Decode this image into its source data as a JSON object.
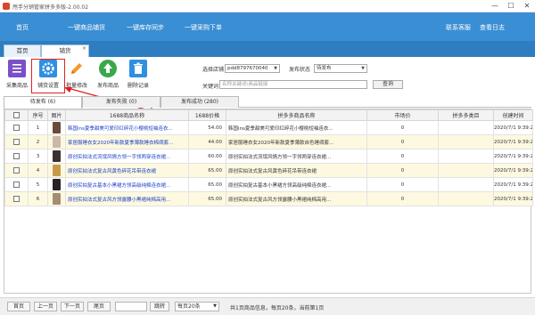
{
  "window": {
    "title": "甩手分销管家拼多多版-2.00.02",
    "controls": [
      "—",
      "☐",
      "✕"
    ]
  },
  "menu": {
    "items": [
      "首页",
      "一键商品铺货",
      "一键库存同步",
      "一键采购下单"
    ],
    "right_items": [
      "联系客服",
      "查看日志"
    ]
  },
  "tabs": [
    {
      "label": "首页",
      "active": false
    },
    {
      "label": "铺货",
      "active": true
    }
  ],
  "toolbar": {
    "buttons": [
      {
        "label": "采集商品",
        "icon": "collect-icon",
        "color": "#7b4fc8"
      },
      {
        "label": "铺货设置",
        "icon": "gear-icon",
        "color": "#2f8fe0"
      },
      {
        "label": "批量修改",
        "icon": "pencil-icon",
        "color": "#f39a2a"
      },
      {
        "label": "发布商品",
        "icon": "upload-icon",
        "color": "#3aa84a"
      },
      {
        "label": "删除记录",
        "icon": "trash-icon",
        "color": "#2f8fe0"
      }
    ],
    "store_label": "选择店铺",
    "store_value": "pdd8797670040",
    "status_label": "发布状态",
    "status_value": "待发布",
    "keyword_label": "关键词",
    "keyword_placeholder": "名称关键词\\商品链接",
    "query_label": "查询",
    "annotation": "1"
  },
  "subtabs": [
    {
      "label": "待发布 (6)",
      "active": true
    },
    {
      "label": "发布失败 (0)",
      "active": false
    },
    {
      "label": "发布成功 (280)",
      "active": false
    }
  ],
  "table": {
    "headers": [
      "",
      "序号",
      "图片",
      "1688商品名称",
      "1688价格",
      "拼多多商品名称",
      "市场价",
      "拼多多类目",
      "创建时间"
    ],
    "rows": [
      {
        "no": "1",
        "name1688": "韩国ins夏季甜美可爱印红碎花小樱桃短袖连衣...",
        "price": "54.00",
        "pdd_name": "韩国ins夏季甜美可爱印红碎花小樱桃短袖连衣...",
        "market": "0",
        "category": "",
        "created": "2020/7/1 9:39:22",
        "thumb": "#6b4a3a"
      },
      {
        "no": "2",
        "name1688": "家居服睡衣女2020年新款夏季薄款睡衣棉绸套...",
        "price": "44.00",
        "pdd_name": "家居服睡衣女2020年新款夏季薄款自色睡绸套...",
        "market": "0",
        "category": "",
        "created": "2020/7/1 9:39:21",
        "thumb": "#c9b9a6"
      },
      {
        "no": "3",
        "name1688": "原创实拍法式流氓风情方领一字领两穿连衣裙...",
        "price": "60.00",
        "pdd_name": "原创实拍法式流氓风情方领一字领两穿连衣裙...",
        "market": "0",
        "category": "",
        "created": "2020/7/1 9:39:22",
        "thumb": "#3c3030"
      },
      {
        "no": "4",
        "name1688": "原创实拍法式复古风黄色碎花吊带连衣裙",
        "price": "65.00",
        "pdd_name": "原创实拍法式复古风黄色碎花吊带连衣裙",
        "market": "0",
        "category": "",
        "created": "2020/7/1 9:39:22",
        "thumb": "#c89a48"
      },
      {
        "no": "5",
        "name1688": "原创实拍复古基本小黑裙方领高级纯棉连衣裙...",
        "price": "65.00",
        "pdd_name": "原创实拍复古基本小黑裙方领高级纯棉连衣裙...",
        "market": "0",
        "category": "",
        "created": "2020/7/1 9:39:22",
        "thumb": "#2a2226"
      },
      {
        "no": "6",
        "name1688": "原创实拍法式复古风方领露腰小黑裙纯棉高用...",
        "price": "65.00",
        "pdd_name": "原创实拍法式复古风方领露腰小黑裙纯棉高用...",
        "market": "0",
        "category": "",
        "created": "2020/7/1 9:39:22",
        "thumb": "#a58d6f"
      }
    ]
  },
  "pager": {
    "first": "首页",
    "prev": "上一页",
    "next": "下一页",
    "last": "尾页",
    "jump": "跳转",
    "page_size": "每页20条",
    "summary": "共1页商品信息，每页20条，当前第1页"
  }
}
